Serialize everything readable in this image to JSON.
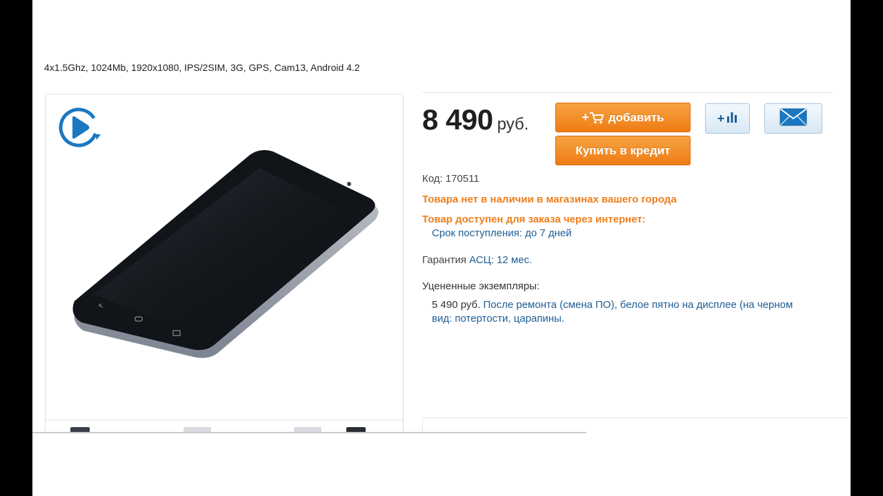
{
  "product": {
    "specs": "4x1.5Ghz, 1024Mb, 1920x1080, IPS/2SIM, 3G, GPS, Cam13, Android 4.2",
    "price": "8 490",
    "currency": "руб.",
    "code_label": "Код: 170511"
  },
  "buttons": {
    "add_label": "добавить",
    "add_prefix": "+",
    "credit_label": "Купить в кредит",
    "compare_prefix": "+"
  },
  "availability": {
    "no_stock": "Товара нет в наличии в магазинах вашего города",
    "online": "Товар доступен для заказа через интернет:",
    "delivery": "Срок поступления: до 7 дней"
  },
  "warranty": {
    "label": "Гарантия",
    "link": "АСЦ",
    "value": ": 12 мес."
  },
  "used": {
    "title": "Уцененные экземпляры:",
    "price": "5 490 руб.",
    "description": "После ремонта (смена ПО), белое пятно на дисплее (на черном",
    "description_line2": "вид: потертости, царапины."
  },
  "colors": {
    "accent_orange": "#ef7b14",
    "link_blue": "#1d5c93",
    "play_blue": "#1a78c2"
  },
  "icons": {
    "play": "play-video-icon",
    "cart": "cart-icon",
    "compare": "bar-chart-icon",
    "mail": "envelope-icon"
  }
}
